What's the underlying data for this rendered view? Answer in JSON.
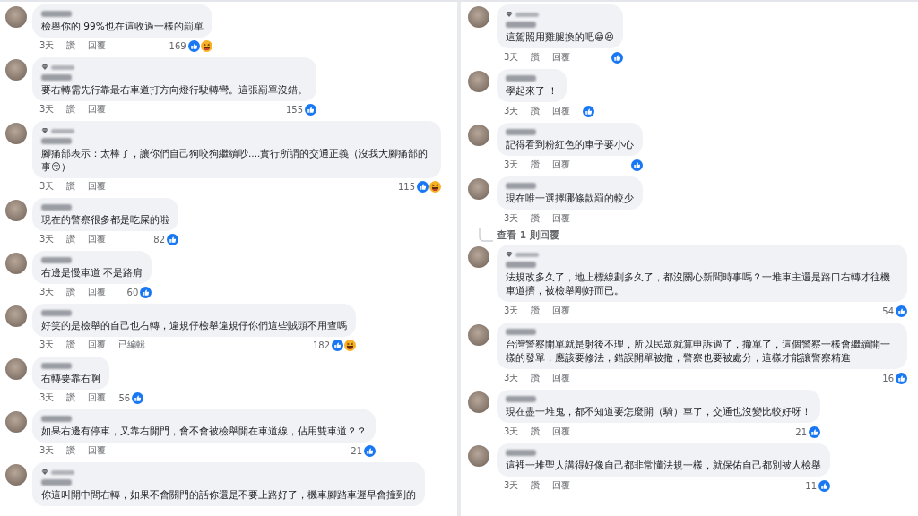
{
  "panels": [
    {
      "comments": [
        {
          "top_fan": false,
          "text": "檢舉你的 99%也在這收過一樣的罰單",
          "time": "3天",
          "like": "讚",
          "reply": "回覆",
          "count": "169",
          "reactions": [
            {
              "kind": "like"
            },
            {
              "kind": "haha"
            }
          ]
        },
        {
          "top_fan": true,
          "text": "要右轉需先行靠最右車道打方向燈行駛轉彎。這張罰單沒錯。",
          "time": "3天",
          "like": "讚",
          "reply": "回覆",
          "count": "155",
          "reactions": [
            {
              "kind": "like"
            }
          ]
        },
        {
          "top_fan": true,
          "text": "腳痛部表示：太棒了，讓你們自己狗咬狗繼續吵....實行所謂的交通正義（沒我大腳痛部的事😏）",
          "time": "3天",
          "like": "讚",
          "reply": "回覆",
          "count": "115",
          "reactions": [
            {
              "kind": "like"
            },
            {
              "kind": "haha"
            }
          ]
        },
        {
          "top_fan": false,
          "text": "現在的警察很多都是吃屎的啦",
          "time": "3天",
          "like": "讚",
          "reply": "回覆",
          "count": "82",
          "reactions": [
            {
              "kind": "like"
            }
          ]
        },
        {
          "top_fan": false,
          "text": "右邊是慢車道 不是路肩",
          "time": "3天",
          "like": "讚",
          "reply": "回覆",
          "count": "60",
          "reactions": [
            {
              "kind": "like"
            }
          ]
        },
        {
          "top_fan": false,
          "text": "好笑的是檢舉的自己也右轉，違規仔檢舉違規仔你們這些賊頭不用查嗎",
          "time": "3天",
          "like": "讚",
          "reply": "回覆",
          "edited": "已編輯",
          "count": "182",
          "reactions": [
            {
              "kind": "like"
            },
            {
              "kind": "haha"
            }
          ]
        },
        {
          "top_fan": false,
          "text": "右轉要靠右啊",
          "time": "3天",
          "like": "讚",
          "reply": "回覆",
          "count": "56",
          "reactions": [
            {
              "kind": "like"
            }
          ]
        },
        {
          "top_fan": false,
          "text": "如果右邊有停車，又靠右開門，會不會被檢舉開在車道線，佔用雙車道？？",
          "time": "3天",
          "like": "讚",
          "reply": "回覆",
          "count": "21",
          "reactions": [
            {
              "kind": "like"
            }
          ]
        },
        {
          "top_fan": true,
          "text": "你這叫開中間右轉，如果不會關門的話你還是不要上路好了，機車腳踏車遲早會撞到的"
        }
      ]
    },
    {
      "comments": [
        {
          "top_fan": true,
          "text": "這駕照用雞腿換的吧😁😆",
          "time": "3天",
          "like": "讚",
          "reply": "回覆",
          "reactions": [
            {
              "kind": "like"
            }
          ]
        },
        {
          "top_fan": false,
          "text": "學起來了 ！",
          "time": "3天",
          "like": "讚",
          "reply": "回覆",
          "reactions": [
            {
              "kind": "like"
            }
          ]
        },
        {
          "top_fan": false,
          "text": "記得看到粉紅色的車子要小心",
          "time": "3天",
          "like": "讚",
          "reply": "回覆",
          "reactions": [
            {
              "kind": "like"
            }
          ]
        },
        {
          "top_fan": false,
          "text": "現在唯一選擇哪條款罰的較少",
          "time": "3天",
          "like": "讚",
          "reply": "回覆",
          "view_replies": "查看 1 則回覆"
        },
        {
          "top_fan": true,
          "text": "法規改多久了，地上標線劃多久了，都沒關心新聞時事嗎？一堆車主還是路口右轉才往機車道擠，被檢舉剛好而已。",
          "time": "3天",
          "like": "讚",
          "reply": "回覆",
          "count": "54",
          "reactions": [
            {
              "kind": "like"
            }
          ]
        },
        {
          "top_fan": false,
          "text": "台灣警察開單就是射後不理，所以民眾就算申訴過了，撤單了，這個警察一樣會繼續開一樣的發單，應該要修法，錯誤開單被撤，警察也要被處分，這樣才能讓警察精進",
          "time": "3天",
          "like": "讚",
          "reply": "回覆",
          "count": "16",
          "reactions": [
            {
              "kind": "like"
            }
          ]
        },
        {
          "top_fan": false,
          "text": "現在盡一堆鬼，都不知道要怎麼開（騎）車了，交通也沒變比較好呀！",
          "time": "3天",
          "like": "讚",
          "reply": "回覆",
          "count": "21",
          "reactions": [
            {
              "kind": "like"
            }
          ]
        },
        {
          "top_fan": false,
          "text": "這裡一堆聖人講得好像自己都非常懂法規一樣，就保佑自己都別被人檢舉",
          "time": "3天",
          "like": "讚",
          "reply": "回覆",
          "count": "11",
          "reactions": [
            {
              "kind": "like"
            }
          ]
        }
      ]
    }
  ]
}
